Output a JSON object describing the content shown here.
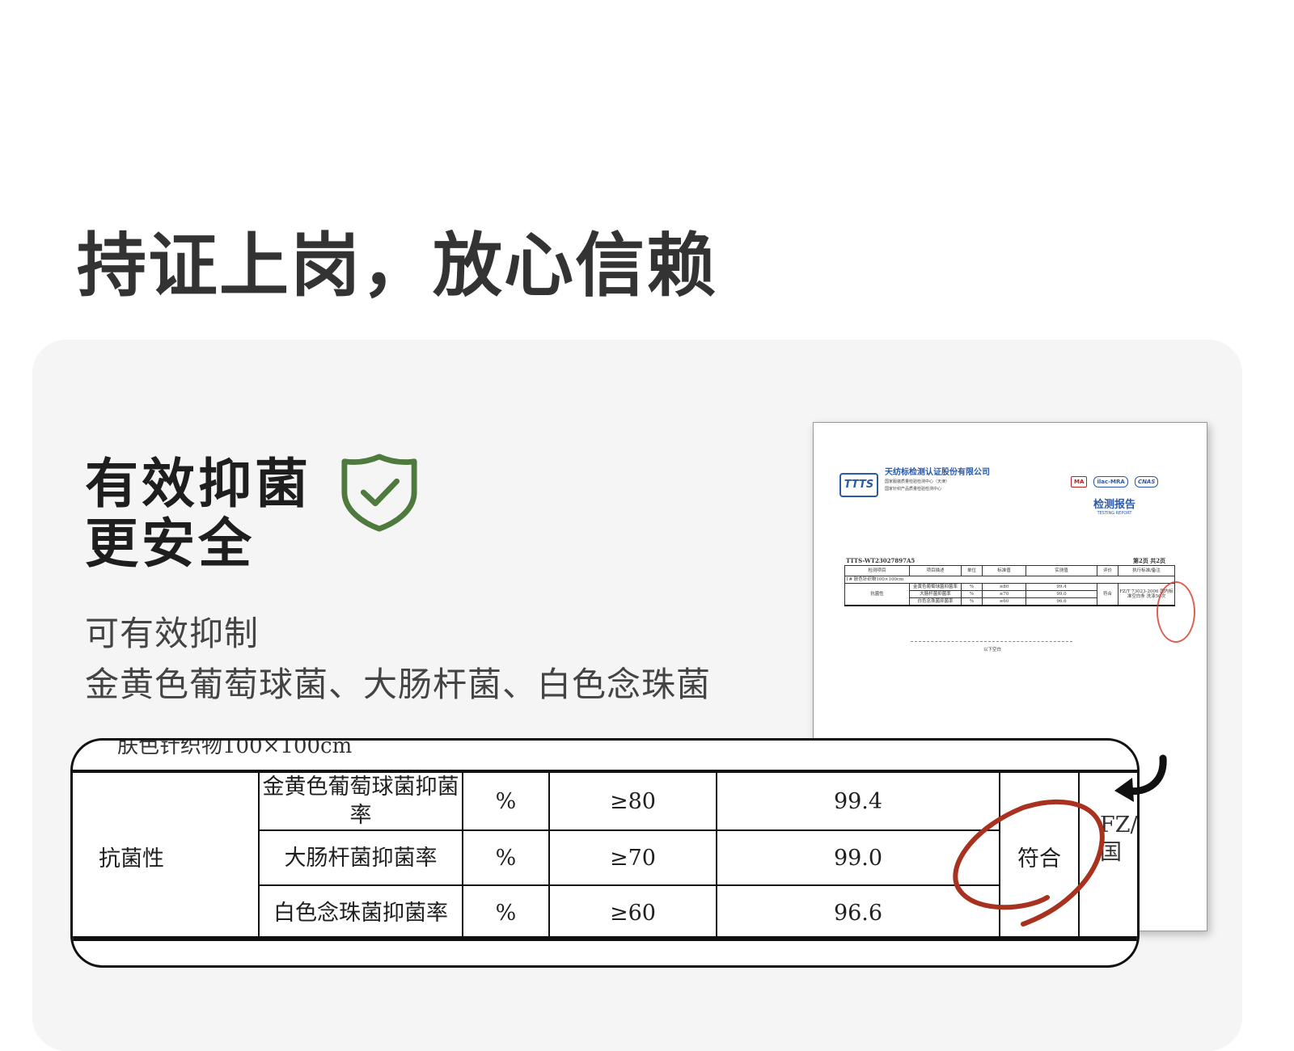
{
  "headline": "持证上岗，放心信赖",
  "feature": {
    "title_lines": [
      "有效抑菌",
      "更安全"
    ],
    "icon": "shield-check-icon",
    "icon_color": "#4e7a3e",
    "description_lines": [
      "可有效抑制",
      "金黄色葡萄球菌、大肠杆菌、白色念珠菌"
    ]
  },
  "report": {
    "company": "天纺标检测认证股份有限公司",
    "centers": [
      "国家服装质量检验检测中心（天津）",
      "国家针织产品质量检验检测中心"
    ],
    "logo_text": "TTTS",
    "cert_logos": [
      "MA",
      "ilac-MRA",
      "CNAS"
    ],
    "title_cn": "检测报告",
    "title_en": "TESTING REPORT",
    "report_no": "TTTS-WT23027897A5",
    "page": "第2页 共2页",
    "columns": [
      "检测项目",
      "项目描述",
      "单位",
      "标准值",
      "实测值",
      "评价",
      "执行标准/备注"
    ],
    "sample_row": "1#    肤色针织物100×100cm",
    "category": "抗菌性",
    "rows": [
      {
        "item": "金黄色葡萄球菌抑菌率",
        "unit": "%",
        "standard": "≥80",
        "measured": "99.4"
      },
      {
        "item": "大肠杆菌抑菌率",
        "unit": "%",
        "standard": "≥70",
        "measured": "99.0"
      },
      {
        "item": "白色念珠菌抑菌率",
        "unit": "%",
        "standard": "≥60",
        "measured": "96.6"
      }
    ],
    "evaluation": "符合",
    "standard_note": "FZ/T 73023-2006 国内标准空白条 洗涤50次",
    "end_note": "以下空白",
    "stamp_color": "#d23a2a"
  },
  "magnified": {
    "sample_row": "肤色针织物100×100cm",
    "category": "抗菌性",
    "rows": [
      {
        "item": "金黄色葡萄球菌抑菌率",
        "unit": "%",
        "standard": "≥80",
        "measured": "99.4"
      },
      {
        "item": "大肠杆菌抑菌率",
        "unit": "%",
        "standard": "≥70",
        "measured": "99.0"
      },
      {
        "item": "白色念珠菌抑菌率",
        "unit": "%",
        "standard": "≥60",
        "measured": "96.6"
      }
    ],
    "evaluation": "符合",
    "standard_lines": [
      "FZ/",
      "国"
    ],
    "annotation_color": "#a8321f"
  }
}
